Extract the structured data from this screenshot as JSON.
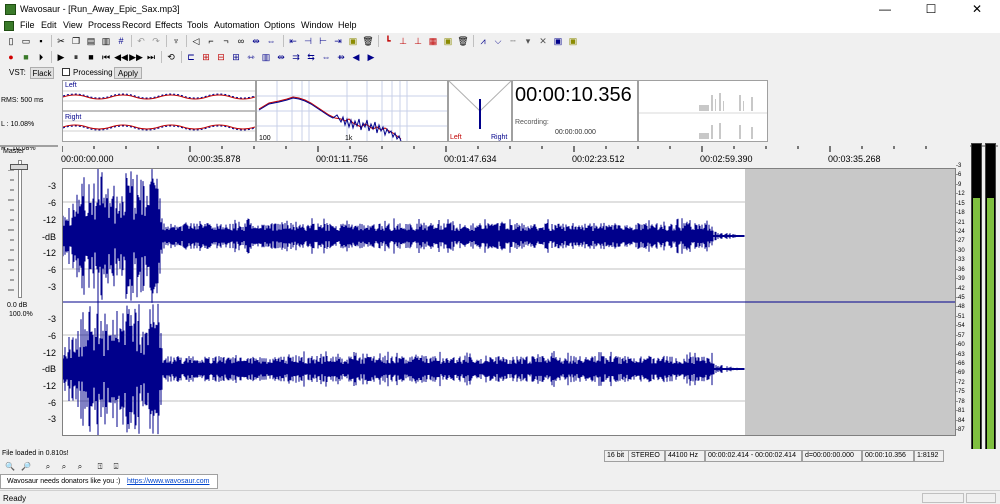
{
  "window": {
    "title": "Wavosaur - [Run_Away_Epic_Sax.mp3]",
    "minimize": "—",
    "maximize": "☐",
    "close": "✕"
  },
  "menu": [
    "File",
    "Edit",
    "View",
    "Process",
    "Record",
    "Effects",
    "Tools",
    "Automation",
    "Options",
    "Window",
    "Help"
  ],
  "vst": {
    "label": "VST:",
    "flatten_label": "Flack",
    "processing_label": "Processing",
    "apply_label": "Apply"
  },
  "analyzer": {
    "rms_line1": "RMS: 500 ms",
    "rms_line2": "L : 10.08%",
    "rms_line3": "R : 10.08%",
    "left_label": "Left",
    "right_label": "Right",
    "spec_100": "100",
    "spec_1k": "1k",
    "phase_left": "Left",
    "phase_right": "Right",
    "time_display": "00:00:10.356",
    "recording_label": "Recording:",
    "recording_time": "00:00:00.000"
  },
  "master": {
    "label": "Master",
    "db_value": "0.0 dB",
    "percent_value": "100.0%"
  },
  "timeline": [
    "00:00:00.000",
    "00:00:35.878",
    "00:01:11.756",
    "00:01:47.634",
    "00:02:23.512",
    "00:02:59.390",
    "00:03:35.268"
  ],
  "db_labels": [
    "-3",
    "-6",
    "-12",
    "-dB",
    "-12",
    "-6",
    "-3"
  ],
  "vu_labels": [
    "-3",
    "-6",
    "-9",
    "-12",
    "-15",
    "-18",
    "-21",
    "-24",
    "-27",
    "-30",
    "-33",
    "-36",
    "-39",
    "-42",
    "-45",
    "-48",
    "-51",
    "-54",
    "-57",
    "-60",
    "-63",
    "-66",
    "-69",
    "-72",
    "-75",
    "-78",
    "-81",
    "-84",
    "-87"
  ],
  "status": {
    "message": "File loaded in 0.810s!",
    "bits": "16 bit",
    "channels": "STEREO",
    "rate": "44100 Hz",
    "selection": "00:00:02.414 - 00:00:02.414",
    "duration": "d=00:00:00.000",
    "position": "00:00:10.356",
    "zoom": "1:8192",
    "donators": "Wavosaur needs donators like you :)",
    "url": "https://www.wavosaur.com",
    "ready": "Ready"
  },
  "colors": {
    "waveform": "#00008b",
    "vu_green": "#7fbf3f",
    "empty_region": "#c8c8c8"
  }
}
